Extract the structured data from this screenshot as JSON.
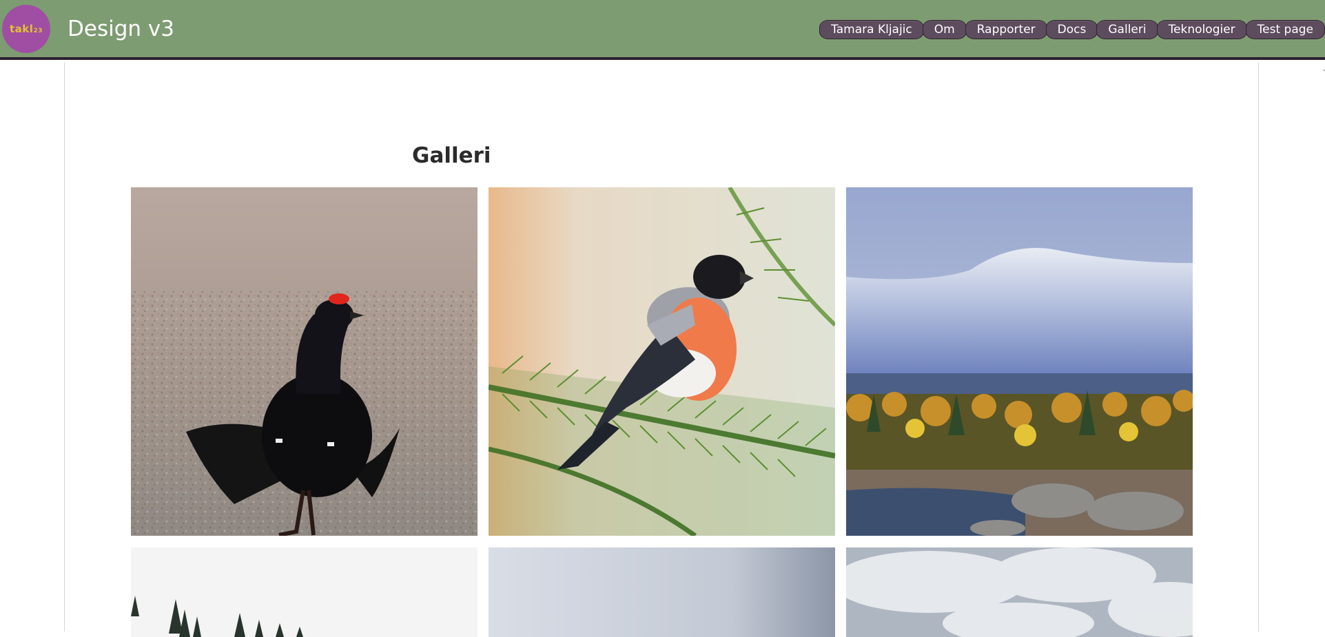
{
  "header": {
    "logo_text": "takl",
    "logo_sub": "23",
    "title": "Design v3"
  },
  "nav": {
    "items": [
      "Tamara Kljajic",
      "Om",
      "Rapporter",
      "Docs",
      "Galleri",
      "Teknologier",
      "Test page"
    ]
  },
  "main": {
    "heading": "Galleri"
  },
  "colors": {
    "header_bg": "#7e9c72",
    "nav_pill": "#5d4b5e",
    "logo_bg": "#9f4ea3",
    "logo_text": "#e5c230"
  }
}
